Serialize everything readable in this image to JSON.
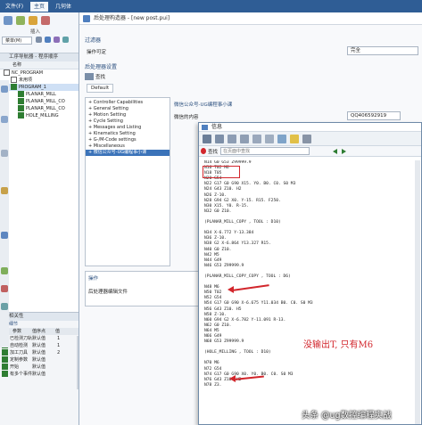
{
  "ribbon": {
    "tabs": [
      "文件(F)",
      "主页",
      "几何体"
    ]
  },
  "window": {
    "title": "后处理构造器 - [new post.pui]"
  },
  "filter": {
    "section_label": "过滤器",
    "machine_label": "操作可定",
    "dropdown_value": "完全"
  },
  "post_settings": {
    "section_label": "后处理器设置",
    "tab_search": "查找",
    "tab_default": "Default",
    "tree_items": [
      "Controller Capabilities",
      "General Setting",
      "Motion Setting",
      "Cycle Setting",
      "Messages and Listing",
      "Kinematics Setting",
      "G-/M-Code settings",
      "Miscellaneous",
      "微信公众号-UG编程事小课"
    ],
    "right_header": "微信公众号-UG编程事小课",
    "right_field_label": "微信的内容",
    "right_field_value": "QQ406592919",
    "ops_label": "操作",
    "ops_item": "后处理器编辑文件"
  },
  "left_panel": {
    "toolbar_label": "插入",
    "dropdown_label": "菜单(M)",
    "navigator_title": "工序导航器 - 程序顺序",
    "col_name": "名称",
    "rows": [
      {
        "label": "NC_PROGRAM",
        "indent": 0,
        "check": false
      },
      {
        "label": "未用项",
        "indent": 1,
        "check": false
      },
      {
        "label": "PROGRAM_1",
        "indent": 1,
        "check": true
      },
      {
        "label": "PLANAR_MILL",
        "indent": 2,
        "check": true
      },
      {
        "label": "PLANAR_MILL_CO",
        "indent": 2,
        "check": true
      },
      {
        "label": "PLANAR_MILL_CO",
        "indent": 2,
        "check": true
      },
      {
        "label": "HOLE_MILLING",
        "indent": 2,
        "check": true
      }
    ],
    "props_title": "相关性",
    "props_sub": "细节",
    "props_cols": [
      "参数",
      "值序点",
      "值"
    ],
    "props_rows": [
      {
        "name": "已检测刀轨",
        "src": "默认值",
        "val": "1"
      },
      {
        "name": "自动检测",
        "src": "默认值",
        "val": "1"
      },
      {
        "name": "加工刀具",
        "src": "默认值",
        "val": "2"
      },
      {
        "name": "定制参数",
        "src": "默认值",
        "val": ""
      },
      {
        "name": "开始",
        "src": "默认值",
        "val": ""
      },
      {
        "name": "有多个事件",
        "src": "默认值",
        "val": ""
      }
    ]
  },
  "listing": {
    "title": "信息",
    "search_label": "查找",
    "search_placeholder": "在页面中查找",
    "lines": [
      "N14 G0 G53 Z99999.9",
      "N16 T02 M6",
      "N18 T05",
      "N20 G54",
      "N22 G17 G0 G90 X15. Y0. B0. C0. S0 M3",
      "N24 G43 Z10. H2",
      "N26 Z-10.",
      "N28 G94 G2 X0. Y-15. R15. F250.",
      "N30 X15. Y0. R-15.",
      "N32 G0 Z10.",
      "",
      "(PLANAR_MILL_COPY , TOOL : D10)",
      "",
      "N34 X-6.772 Y-13.384",
      "N36 Z-10.",
      "N38 G2 X-6.864 Y13.327 R15.",
      "N40 G0 Z10.",
      "N42 M5",
      "N44 G49",
      "N46 G53 Z99999.9",
      "",
      "(PLANAR_MILL_COPY_COPY , TOOL : D6)",
      "",
      "N48 M6",
      "N50 T02",
      "N52 G54",
      "N54 G17 G0 G90 X-6.675 Y11.034 B0. C0. S0 M3",
      "N56 G43 Z10. H5",
      "N58 Z-10.",
      "N60 G94 G2 X-6.782 Y-11.091 R-13.",
      "N62 G0 Z10.",
      "N64 M5",
      "N66 G49",
      "N68 G53 Z99999.9",
      "",
      "(HOLE_MILLING , TOOL : D10)",
      "",
      "N70 M6",
      "N72 G54",
      "N74 G17 G0 G90 X0. Y0. B0. C0. S0 M3",
      "N76 G43 Z10. H2",
      "N78 Z3."
    ]
  },
  "annotation": {
    "text": "没输出T, 只有M6",
    "color": "#d2262c"
  },
  "watermark": {
    "text": "头条 @ug数控编程实战"
  },
  "colors": {
    "ribbon": "#2f5d95",
    "selection": "#3b73b9",
    "highlight_red": "#d2262c"
  }
}
